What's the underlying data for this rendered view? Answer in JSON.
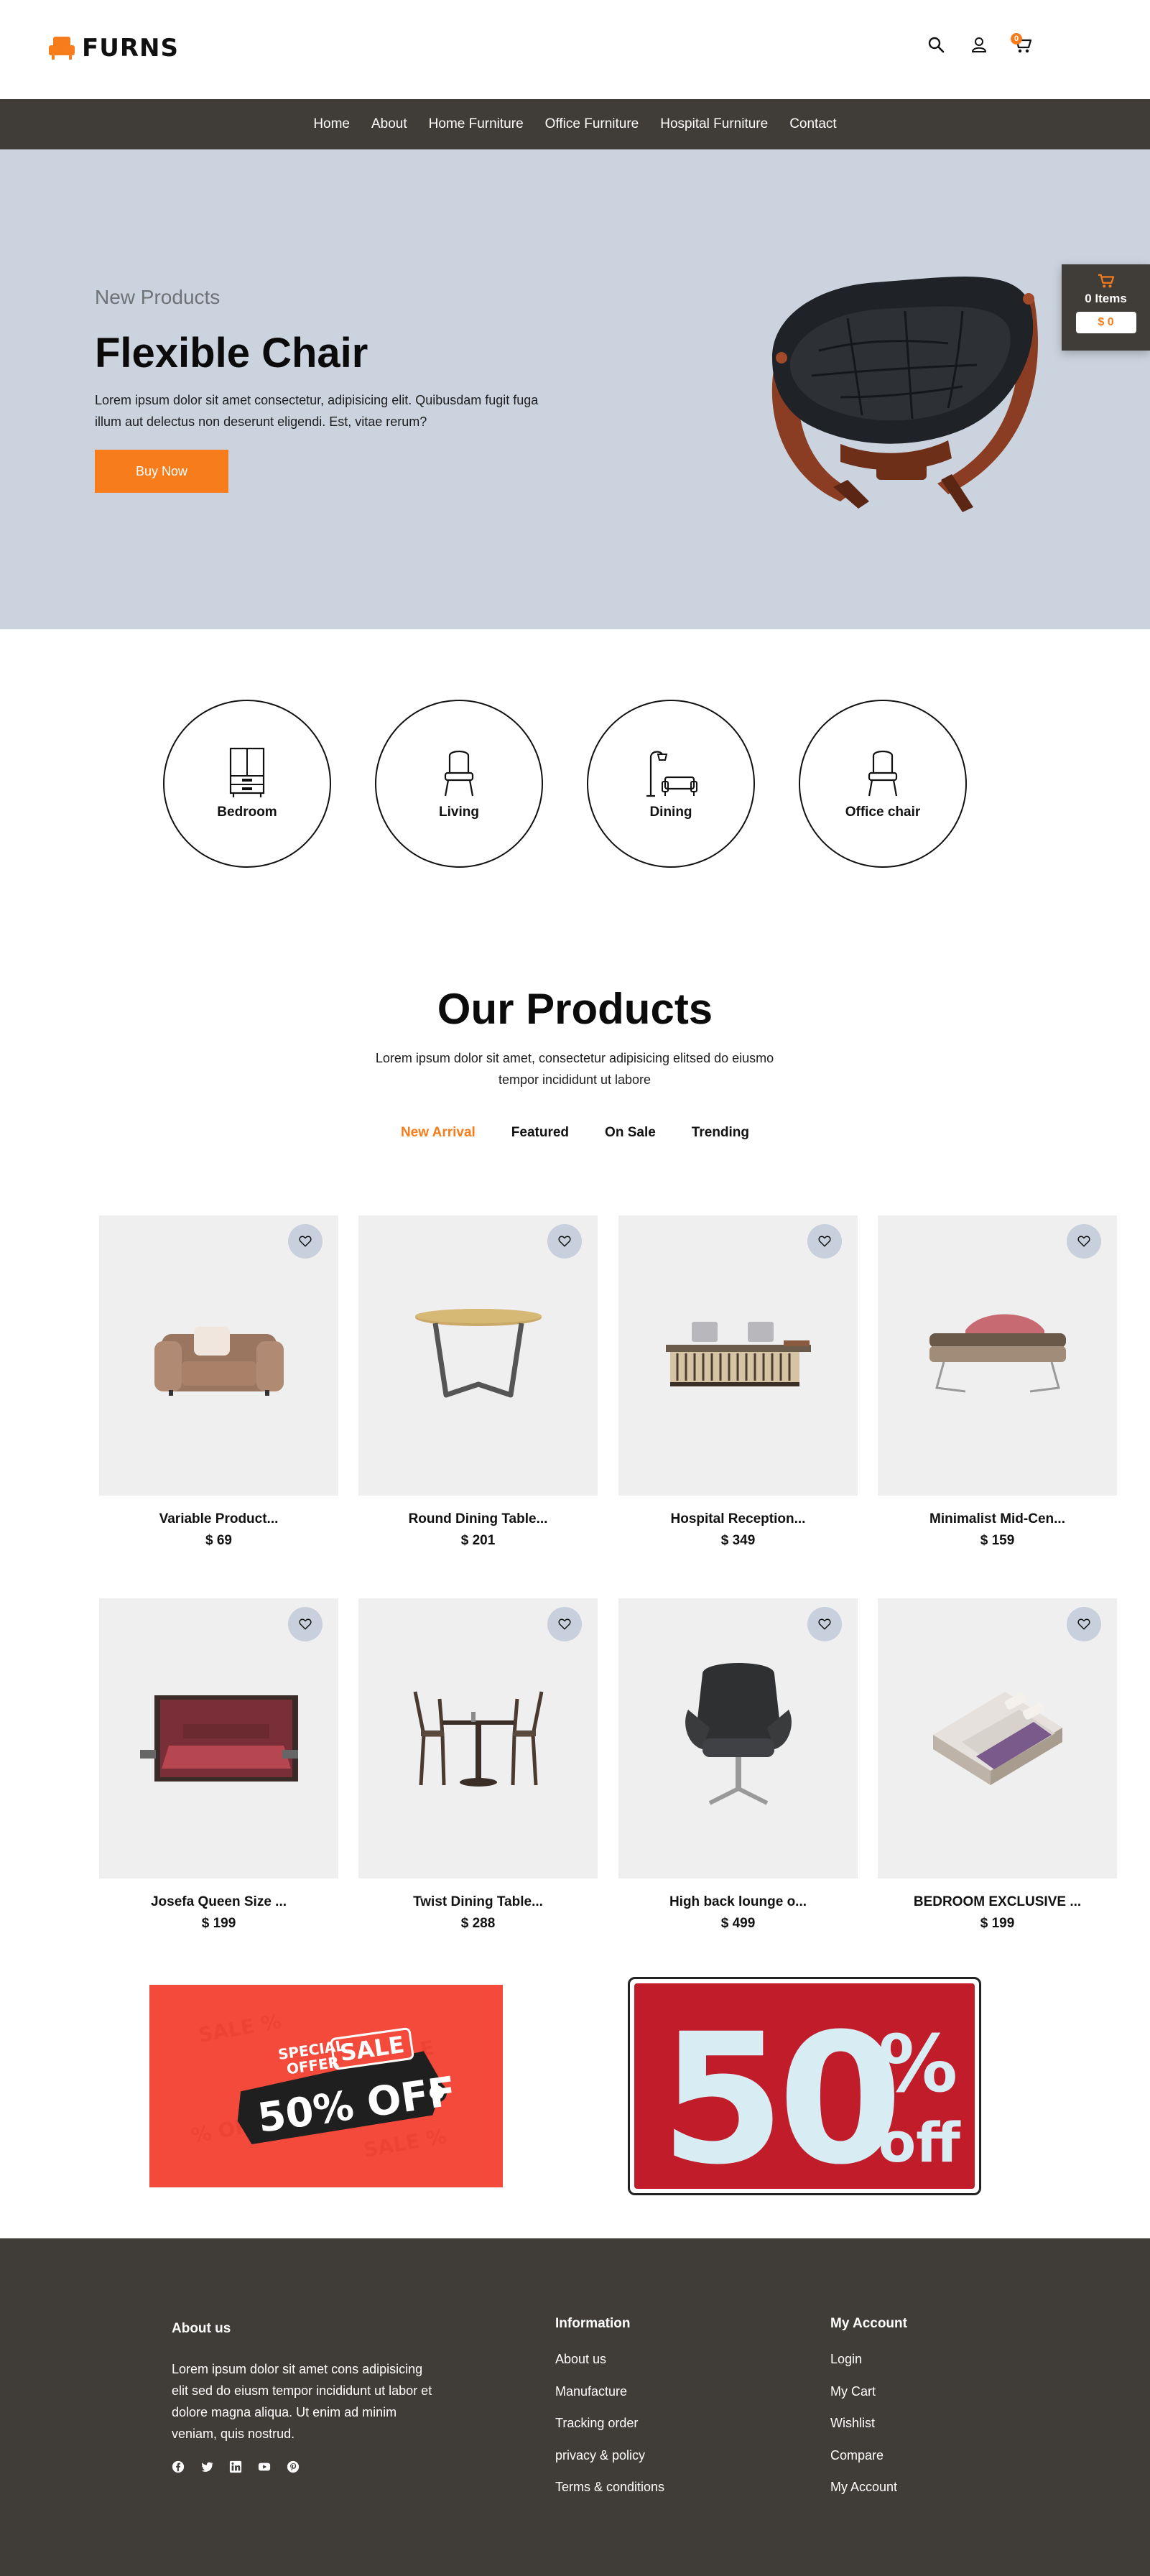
{
  "brand": {
    "name": "FURNS",
    "accent": "#f77c1c",
    "dark": "#403c38"
  },
  "header": {
    "icons": [
      "search-icon",
      "user-icon",
      "cart-icon"
    ],
    "cart_count": "0"
  },
  "nav": {
    "items": [
      {
        "label": "Home"
      },
      {
        "label": "About"
      },
      {
        "label": "Home Furniture"
      },
      {
        "label": "Office Furniture"
      },
      {
        "label": "Hospital Furniture"
      },
      {
        "label": "Contact"
      }
    ]
  },
  "hero": {
    "subtitle": "New Products",
    "title": "Flexible Chair",
    "description": "Lorem ipsum dolor sit amet consectetur, adipisicing elit. Quibusdam fugit fuga illum aut delectus non deserunt eligendi. Est, vitae rerum?",
    "button": "Buy Now"
  },
  "mini_cart": {
    "items": "0 Items",
    "price": "$ 0"
  },
  "categories": [
    {
      "label": "Bedroom",
      "icon": "wardrobe-icon"
    },
    {
      "label": "Living",
      "icon": "chair-icon"
    },
    {
      "label": "Dining",
      "icon": "lamp-sofa-icon"
    },
    {
      "label": "Office chair",
      "icon": "chair-icon"
    }
  ],
  "products_section": {
    "title": "Our Products",
    "description": "Lorem ipsum dolor sit amet, consectetur adipisicing elitsed do eiusmo tempor incididunt ut labore",
    "tabs": [
      {
        "label": "New Arrival",
        "active": true
      },
      {
        "label": "Featured",
        "active": false
      },
      {
        "label": "On Sale",
        "active": false
      },
      {
        "label": "Trending",
        "active": false
      }
    ],
    "products": [
      {
        "name": "Variable Product...",
        "price": "$ 69"
      },
      {
        "name": "Round Dining Table...",
        "price": "$ 201"
      },
      {
        "name": "Hospital Reception...",
        "price": "$ 349"
      },
      {
        "name": "Minimalist Mid-Cen...",
        "price": "$ 159"
      },
      {
        "name": "Josefa Queen Size ...",
        "price": "$ 199"
      },
      {
        "name": "Twist Dining Table...",
        "price": "$ 288"
      },
      {
        "name": "High back lounge o...",
        "price": "$ 499"
      },
      {
        "name": "BEDROOM EXCLUSIVE ...",
        "price": "$ 199"
      }
    ]
  },
  "banners": {
    "left": {
      "tag1": "SPECIAL",
      "tag2": "OFFER",
      "sale": "SALE",
      "headline": "50% OFF"
    },
    "right": {
      "number": "50",
      "percent": "%",
      "off": "off"
    }
  },
  "footer": {
    "about": {
      "heading": "About us",
      "text": "Lorem ipsum dolor sit amet cons adipisicing elit sed do eiusm tempor incididunt ut labor et dolore magna aliqua. Ut enim ad minim veniam, quis nostrud.",
      "socials": [
        "facebook-icon",
        "twitter-icon",
        "linkedin-icon",
        "youtube-icon",
        "pinterest-icon"
      ]
    },
    "information": {
      "heading": "Information",
      "links": [
        "About us",
        "Manufacture",
        "Tracking order",
        "privacy & policy",
        "Terms & conditions"
      ]
    },
    "account": {
      "heading": "My Account",
      "links": [
        "Login",
        "My Cart",
        "Wishlist",
        "Compare",
        "My Account"
      ]
    }
  }
}
